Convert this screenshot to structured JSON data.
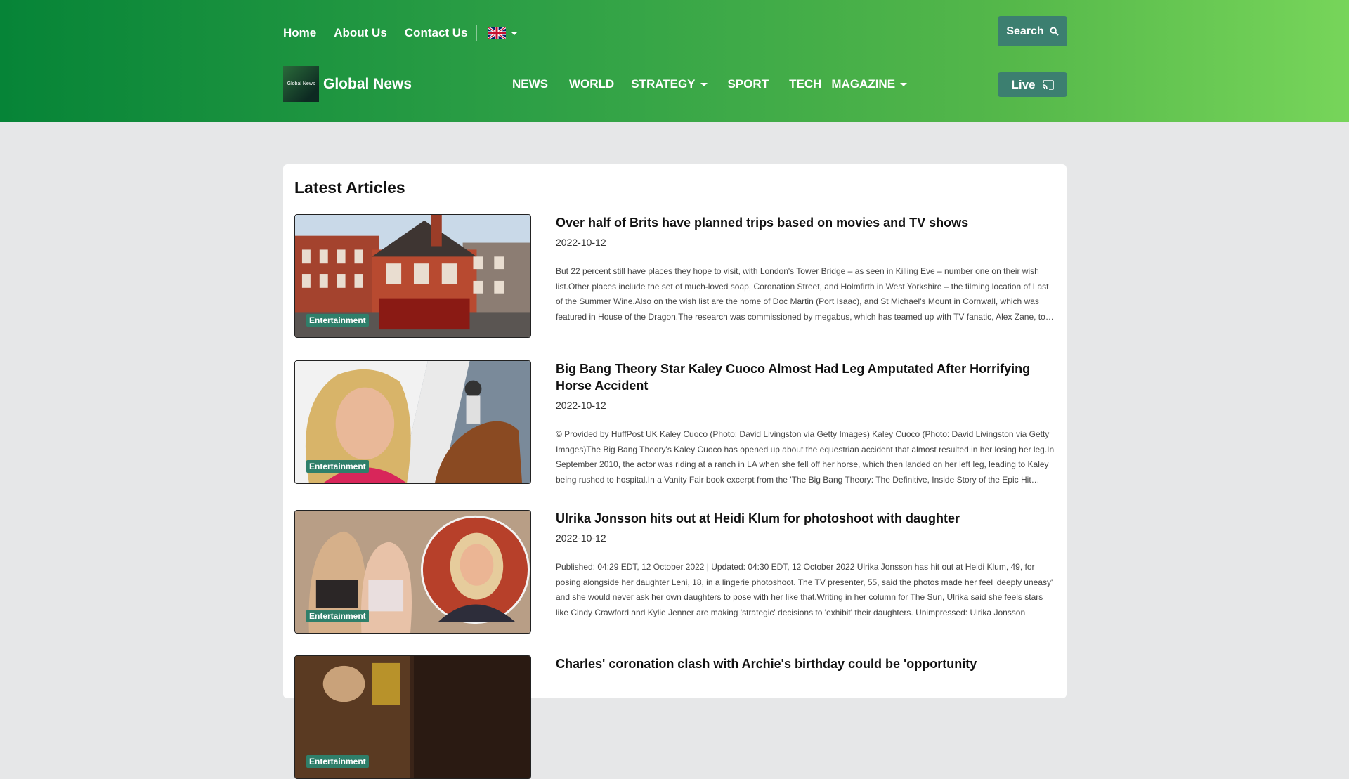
{
  "topnav": {
    "home": "Home",
    "about": "About Us",
    "contact": "Contact Us"
  },
  "logo": {
    "small_text": "Global News",
    "name": "Global News"
  },
  "mainnav": {
    "news": "NEWS",
    "world": "WORLD",
    "strategy": "STRATEGY",
    "sport": "SPORT",
    "tech": "TECH",
    "magazine": "MAGAZINE"
  },
  "buttons": {
    "search": "Search",
    "live": "Live"
  },
  "section_title": "Latest Articles",
  "articles": [
    {
      "category": "Entertainment",
      "title": "Over half of Brits have planned trips based on movies and TV shows",
      "date": "2022-10-12",
      "excerpt": "But 22 percent still have places they hope to visit, with London's Tower Bridge – as seen in Killing Eve – number one on their wish list.Other places include the set of much-loved soap, Coronation Street, and Holmfirth in West Yorkshire – the filming location of Last of the Summer Wine.Also on the wish list are the home of Doc Martin (Port Isaac), and St Michael's Mount in Cornwall, which was featured in House of the Dragon.The research was commissioned by megabus, which has teamed up with TV fanatic, Alex Zane, to create"
    },
    {
      "category": "Entertainment",
      "title": "Big Bang Theory Star Kaley Cuoco Almost Had Leg Amputated After Horrifying Horse Accident",
      "date": "2022-10-12",
      "excerpt": "© Provided by HuffPost UK Kaley Cuoco (Photo: David Livingston via Getty Images) Kaley Cuoco (Photo: David Livingston via Getty Images)The Big Bang Theory's Kaley Cuoco has opened up about the equestrian accident that almost resulted in her losing her leg.In September 2010, the actor was riding at a ranch in LA when she fell off her horse, which then landed on her left leg, leading to Kaley being rushed to hospital.In a Vanity Fair book excerpt from the 'The Big Bang Theory: The Definitive, Inside Story of the Epic Hit Series'"
    },
    {
      "category": "Entertainment",
      "title": "Ulrika Jonsson hits out at Heidi Klum for photoshoot with daughter",
      "date": "2022-10-12",
      "excerpt": "Published: 04:29 EDT, 12 October 2022 | Updated: 04:30 EDT, 12 October 2022 Ulrika Jonsson has hit out at Heidi Klum, 49, for posing alongside her daughter Leni, 18, in a lingerie photoshoot. The TV presenter, 55, said the photos made her feel 'deeply uneasy' and she would never ask her own daughters to pose with her like that.Writing in her column for The Sun, Ulrika said she feels stars like Cindy Crawford and Kylie Jenner are making 'strategic' decisions to 'exhibit' their daughters.  Unimpressed: Ulrika Jonsson"
    },
    {
      "category": "Entertainment",
      "title": "Charles' coronation clash with Archie's birthday could be 'opportunity",
      "date": "",
      "excerpt": ""
    }
  ],
  "colors": {
    "header_start": "#068437",
    "header_end": "#77d55a",
    "button_bg": "#3c7f70",
    "tag_bg": "#2f7f6a",
    "page_bg": "#e6e7e8"
  }
}
